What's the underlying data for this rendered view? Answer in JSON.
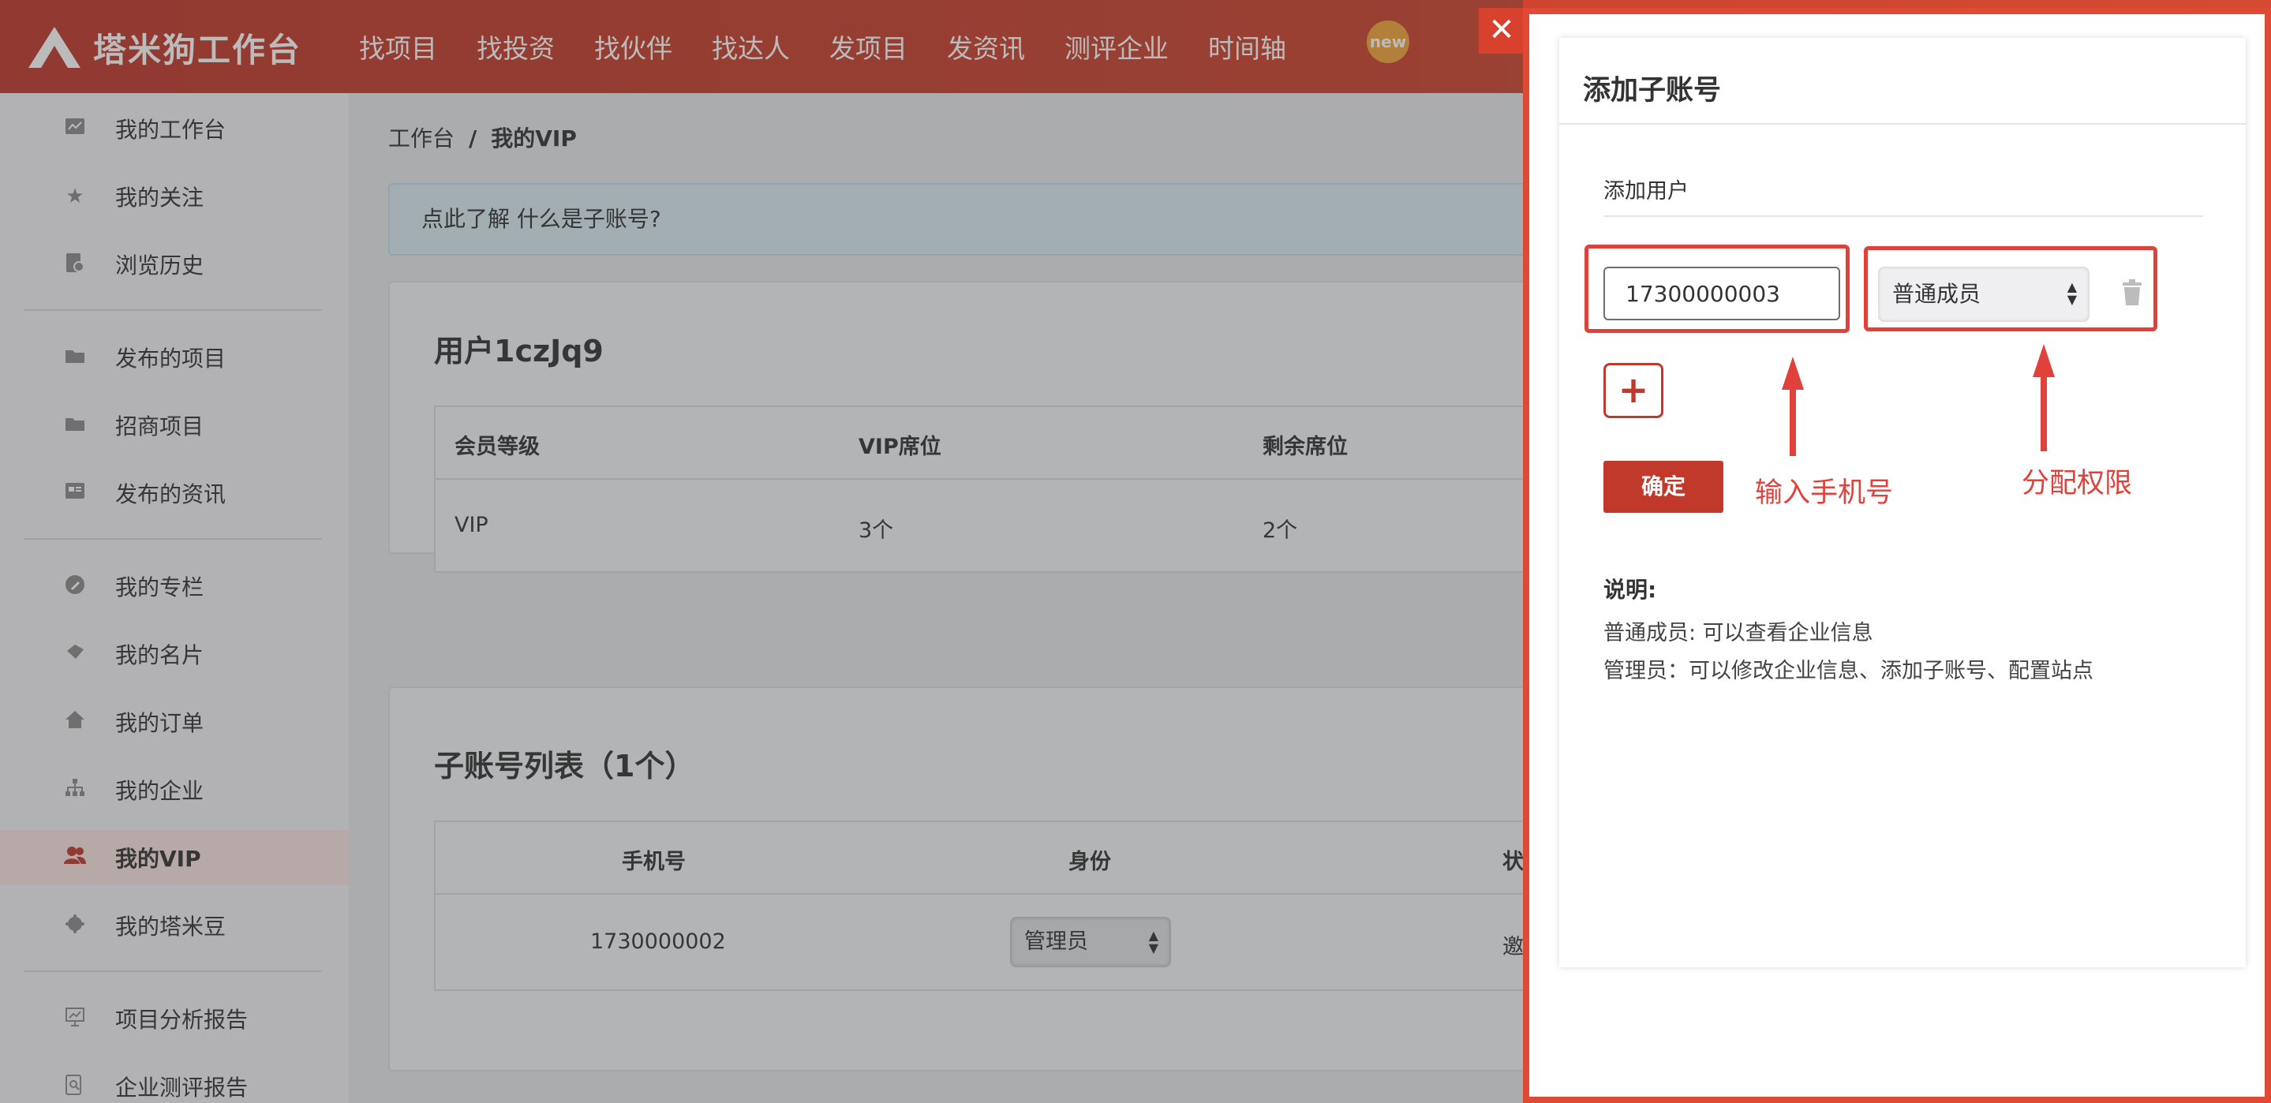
{
  "brand": {
    "name": "塔米狗工作台"
  },
  "nav": {
    "items": [
      "找项目",
      "找投资",
      "找伙伴",
      "找达人",
      "发项目",
      "发资讯",
      "测评企业",
      "时间轴"
    ],
    "badge": "new"
  },
  "sidebar": {
    "items": [
      {
        "label": "我的工作台",
        "icon": "chart-icon"
      },
      {
        "label": "我的关注",
        "icon": "star-icon"
      },
      {
        "label": "浏览历史",
        "icon": "history-icon"
      },
      {
        "label": "发布的项目",
        "icon": "folder-icon"
      },
      {
        "label": "招商项目",
        "icon": "folder-icon"
      },
      {
        "label": "发布的资讯",
        "icon": "news-icon"
      },
      {
        "label": "我的专栏",
        "icon": "column-icon"
      },
      {
        "label": "我的名片",
        "icon": "card-icon"
      },
      {
        "label": "我的订单",
        "icon": "home-icon"
      },
      {
        "label": "我的企业",
        "icon": "org-icon"
      },
      {
        "label": "我的VIP",
        "icon": "vip-users-icon",
        "active": true
      },
      {
        "label": "我的塔米豆",
        "icon": "bean-icon"
      },
      {
        "label": "项目分析报告",
        "icon": "report-icon"
      },
      {
        "label": "企业测评报告",
        "icon": "search-report-icon"
      }
    ]
  },
  "breadcrumb": {
    "root": "工作台",
    "sep": "/",
    "current": "我的VIP"
  },
  "info": {
    "text": "点此了解 什么是子账号?"
  },
  "vip_card": {
    "title": "用户1czJq9",
    "headers": [
      "会员等级",
      "VIP席位",
      "剩余席位"
    ],
    "row": [
      "VIP",
      "3个",
      "2个"
    ]
  },
  "sub_card": {
    "title": "子账号列表（1个）",
    "headers": [
      "手机号",
      "身份",
      "状"
    ],
    "row": {
      "phone": "1730000002",
      "role": "管理员",
      "status": "邀"
    }
  },
  "drawer": {
    "title": "添加子账号",
    "section": "添加用户",
    "phone_value": "17300000003",
    "role_value": "普通成员",
    "add_label": "+",
    "confirm_label": "确定",
    "annotations": {
      "phone": "输入手机号",
      "role": "分配权限"
    },
    "notes": {
      "title": "说明:",
      "lines": [
        "普通成员: 可以查看企业信息",
        "管理员：可以修改企业信息、添加子账号、配置站点"
      ]
    },
    "close_label": "✕"
  },
  "colors": {
    "brand_red": "#c0392b",
    "annotation_red": "#e0423b"
  }
}
